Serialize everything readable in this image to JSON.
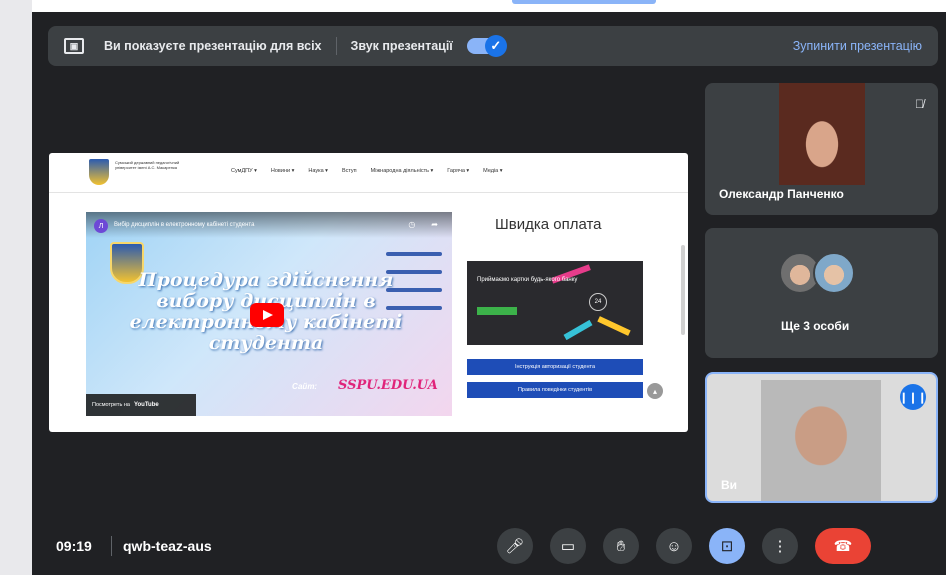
{
  "presentation_bar": {
    "status_text": "Ви показуєте презентацію для всіх",
    "audio_label": "Звук презентації",
    "audio_enabled": true,
    "stop_label": "Зупинити презентацію"
  },
  "shared_screen": {
    "site_logo_text": "Сумський державний педагогічний університет імені А.С. Макаренка",
    "nav_items": [
      "СумДПУ ▾",
      "Новини ▾",
      "Наука ▾",
      "Вступ",
      "Міжнародна діяльність ▾",
      "Гаряча ▾",
      "Медіа ▾"
    ],
    "video": {
      "channel_avatar": "Л",
      "title": "Вибір дисциплін в електронному кабінеті студента",
      "headline": "Процедура здійснення вибору дисциплін в електронному кабінеті студента",
      "site_label": "Сайт:",
      "site_url": "SSPU.EDU.UA",
      "watch_on": "Посмотреть на",
      "watch_brand": "YouTube"
    },
    "payment": {
      "title": "Швидка оплата",
      "promo_text": "Приймаємо картки будь-якого банку",
      "promo_number": "24",
      "buttons": [
        "Інструкція авторизації студента",
        "Правила поведінки студентів"
      ]
    }
  },
  "participants": [
    {
      "name": "Олександр Панченко",
      "muted": true
    },
    {
      "name": "Ще 3 особи"
    },
    {
      "name": "Ви",
      "speaking": true
    }
  ],
  "bottom_bar": {
    "time": "09:19",
    "meeting_code": "qwb-teaz-aus"
  },
  "colors": {
    "background": "#202124",
    "accent": "#8ab4f8",
    "end_call": "#ea4335"
  }
}
